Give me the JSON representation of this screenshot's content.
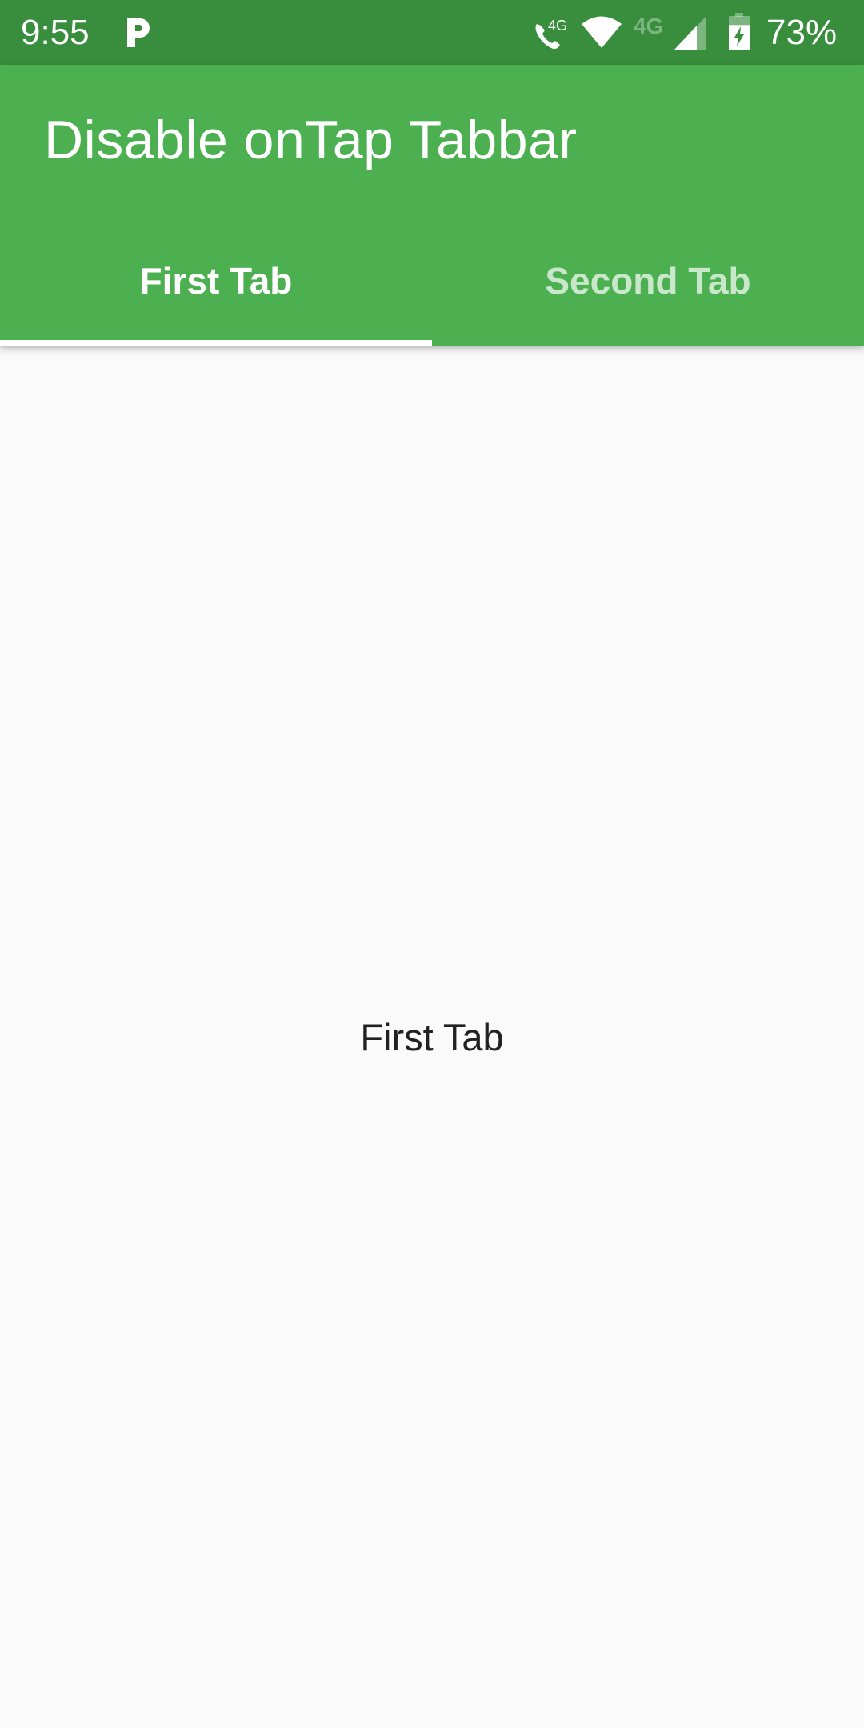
{
  "status_bar": {
    "time": "9:55",
    "notification_icons": [
      "parking-app-icon"
    ],
    "system_icons": [
      "volte-call-icon",
      "wifi-icon",
      "mobile-data-4g-icon",
      "cell-signal-icon",
      "battery-charging-icon"
    ],
    "volte_label": "4G",
    "network_label": "4G",
    "battery_percent_text": "73%",
    "battery_level": 0.73,
    "colors": {
      "background": "#388E3C",
      "foreground": "#FFFFFF"
    }
  },
  "app_bar": {
    "title": "Disable onTap Tabbar",
    "colors": {
      "background": "#4CAF50",
      "title": "#FFFFFF"
    }
  },
  "tabs": [
    {
      "label": "First Tab",
      "selected": true
    },
    {
      "label": "Second Tab",
      "selected": false
    }
  ],
  "tab_colors": {
    "selected": "#FFFFFF",
    "unselected": "#C8E6C9",
    "indicator": "#FFFFFF"
  },
  "content": {
    "text": "First Tab",
    "colors": {
      "background": "#FAFAFA",
      "text": "#212121"
    }
  }
}
